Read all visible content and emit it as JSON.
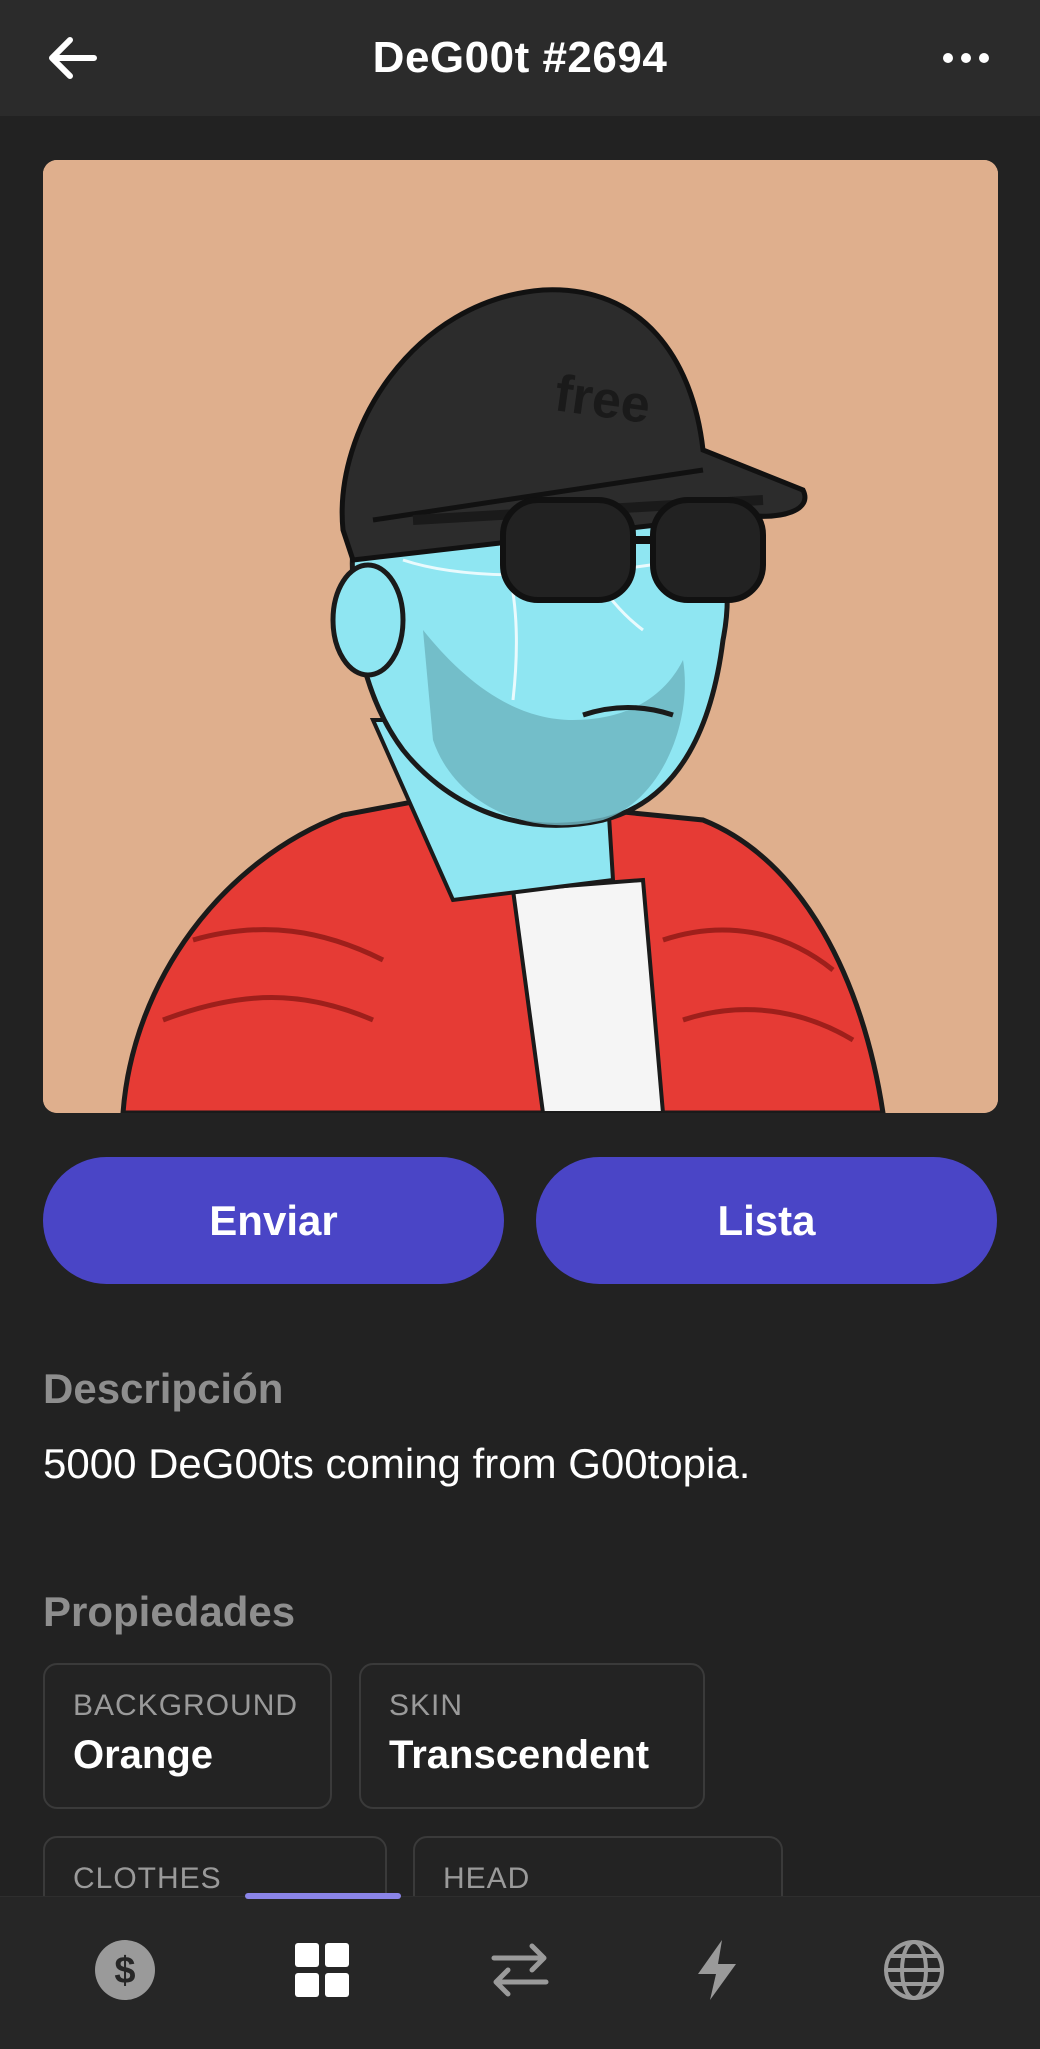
{
  "header": {
    "title": "DeG00t #2694"
  },
  "actions": {
    "send_label": "Enviar",
    "list_label": "Lista"
  },
  "description": {
    "heading": "Descripción",
    "text": "5000 DeG00ts coming from G00topia."
  },
  "properties": {
    "heading": "Propiedades",
    "items": [
      {
        "type": "BACKGROUND",
        "value": "Orange"
      },
      {
        "type": "SKIN",
        "value": "Transcendent"
      },
      {
        "type": "CLOTHES",
        "value": ""
      },
      {
        "type": "HEAD",
        "value": ""
      }
    ]
  },
  "tabbar": {
    "tabs": [
      {
        "icon": "dollar-icon"
      },
      {
        "icon": "grid-icon",
        "active": true
      },
      {
        "icon": "swap-icon"
      },
      {
        "icon": "lightning-icon"
      },
      {
        "icon": "globe-icon"
      }
    ]
  },
  "colors": {
    "accent": "#4a45c6",
    "background": "#222222",
    "image_bg": "#dfaf8d"
  }
}
